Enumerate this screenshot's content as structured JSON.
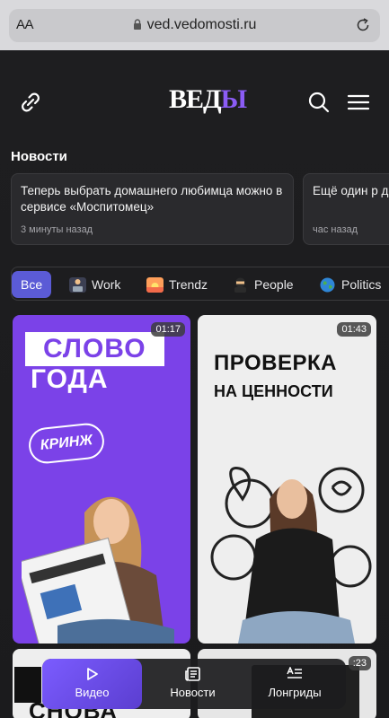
{
  "browser": {
    "aa_label": "AA",
    "url": "ved.vedomosti.ru"
  },
  "site": {
    "logo_part1": "ВЕД",
    "logo_part2": "Ы",
    "news_heading": "Новости",
    "news": [
      {
        "title": "Теперь выбрать домашнего любимца можно в сервисе «Моспитомец»",
        "time": "3 минуты назад"
      },
      {
        "title": "Ещё один р доступен на",
        "time": "час назад"
      }
    ],
    "filters": [
      {
        "label": "Все",
        "active": true
      },
      {
        "label": "Work",
        "icon": "laptop-person-icon"
      },
      {
        "label": "Trendz",
        "icon": "sunset-icon"
      },
      {
        "label": "People",
        "icon": "ninja-icon"
      },
      {
        "label": "Politics",
        "icon": "globe-icon"
      }
    ],
    "tiles": [
      {
        "duration": "01:17",
        "headline1": "СЛОВО",
        "headline2": "ГОДА",
        "badge": "КРИНЖ"
      },
      {
        "duration": "01:43",
        "headline1": "ПРОВЕРКА",
        "headline2": "НА ЦЕННОСТИ"
      },
      {
        "duration": "",
        "headline1": "СНОВА"
      },
      {
        "duration": ":23"
      }
    ],
    "tabbar": {
      "video": "Видео",
      "news": "Новости",
      "longreads": "Лонгриды"
    }
  },
  "colors": {
    "accent": "#8b5cf6",
    "active_chip": "#5b5bd6",
    "tile_purple": "#7b42e8"
  }
}
